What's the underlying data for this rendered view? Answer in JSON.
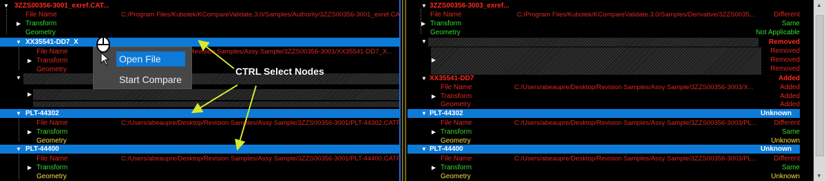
{
  "left": {
    "root_title": "3ZZS00356-3001_exref.CAT...",
    "file_label": "File Name",
    "file_value": "C:/Program Files/Kubotek/KCompareValidate.3.0/Samples/Authority/3ZZS00356-3001_exref.CA...",
    "transform_label": "Transform",
    "geometry_label": "Geometry",
    "node1": "XX35541-DD7_X",
    "node1_file_label": "File Name",
    "node1_file_value": "...Revision Samples/Assy Sample/3ZZS00356-3001/XX35541-DD7_X...",
    "node1_transform": "Transform",
    "node1_geometry": "Geometry",
    "plt1": "PLT-44302",
    "plt1_file_label": "File Name",
    "plt1_file_value": "C:/Users/abeaupre/Desktop/Revision Samples/Assy Sample/3ZZS00356-3001/PLT-44302.CATPart",
    "plt1_transform": "Transform",
    "plt1_geometry": "Geometry",
    "plt2": "PLT-44400",
    "plt2_file_label": "File Name",
    "plt2_file_value": "C:/Users/abeaupre/Desktop/Revision Samples/Assy Sample/3ZZS00356-3001/PLT-44400.CATPart",
    "plt2_transform": "Transform",
    "plt2_geometry": "Geometry"
  },
  "context_menu": {
    "open_file": "Open File",
    "start_compare": "Start Compare"
  },
  "annotation": "CTRL Select Nodes",
  "right": {
    "root_title": "3ZZS00356-3003_exref...",
    "file_label": "File Name",
    "file_value": "C:/Program Files/Kubotek/KCompareValidate.3.0/Samples/Derivative/3ZZS0035...",
    "file_status": "Different",
    "transform_label": "Transform",
    "transform_status": "Same",
    "geometry_label": "Geometry",
    "geometry_status": "Not Applicable",
    "removed_header": "Removed",
    "removed_1": "Removed",
    "removed_2": "Removed",
    "removed_3": "Removed",
    "added_node": "XX35541-DD7",
    "added_header": "Added",
    "added_file_label": "File Name",
    "added_file_value": "C:/Users/abeaupre/Desktop/Revision Samples/Assy Sample/3ZZS00356-3003/X...",
    "added_file_status": "Added",
    "added_transform": "Transform",
    "added_transform_status": "Added",
    "added_geometry": "Geometry",
    "added_geometry_status": "Added",
    "plt1": "PLT-44302",
    "plt1_status": "Unknown",
    "plt1_file_label": "File Name",
    "plt1_file_value": "C:/Users/abeaupre/Desktop/Revision Samples/Assy Sample/3ZZS00356-3003/PL...",
    "plt1_file_status": "Different",
    "plt1_transform": "Transform",
    "plt1_transform_status": "Same",
    "plt1_geometry": "Geometry",
    "plt1_geometry_status": "Unknown",
    "plt2": "PLT-44400",
    "plt2_status": "Unknown",
    "plt2_file_label": "File Name",
    "plt2_file_value": "C:/Users/abeaupre/Desktop/Revision Samples/Assy Sample/3ZZS00356-3003/PL...",
    "plt2_file_status": "Different",
    "plt2_transform": "Transform",
    "plt2_transform_status": "Same",
    "plt2_geometry": "Geometry",
    "plt2_geometry_status": "Unknown"
  },
  "colors": {
    "selection": "#0d7ad8",
    "red": "#e0281e",
    "green": "#33dd33",
    "yellow": "#f0e040",
    "arrow": "#d8e830"
  }
}
